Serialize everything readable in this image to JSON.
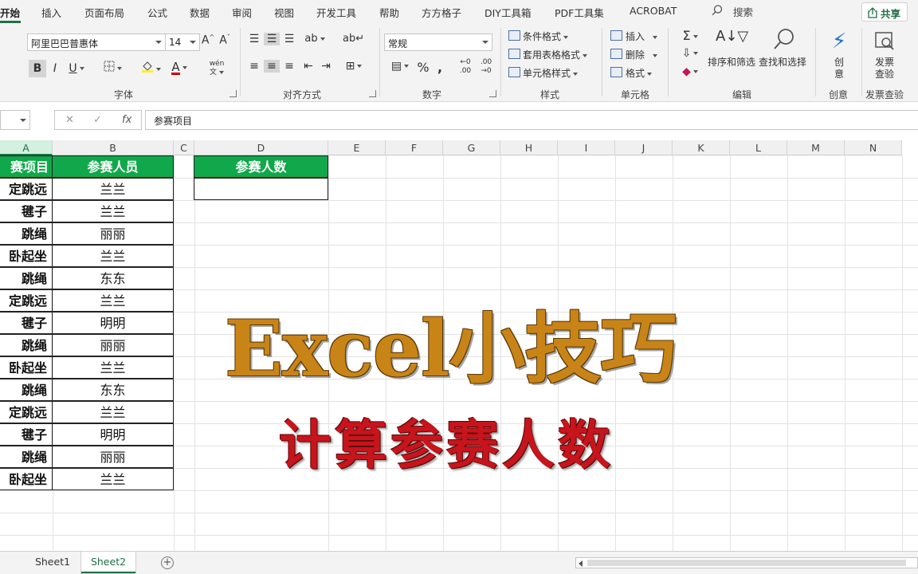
{
  "ribbon_tabs": [
    "开始",
    "插入",
    "页面布局",
    "公式",
    "数据",
    "审阅",
    "视图",
    "开发工具",
    "帮助",
    "方方格子",
    "DIY工具箱",
    "PDF工具集",
    "ACROBAT"
  ],
  "search_label": "搜索",
  "share_label": "共享",
  "font": {
    "name": "阿里巴巴普惠体",
    "size": "14",
    "bold": "B",
    "italic": "I",
    "underline": "U",
    "grow": "A^",
    "shrink": "A˅",
    "phonetic": "wén"
  },
  "number_format": "常规",
  "styles": {
    "conditional": "条件格式",
    "table": "套用表格格式",
    "cell": "单元格样式"
  },
  "cells_group": {
    "insert": "插入",
    "delete": "删除",
    "format": "格式"
  },
  "edit_group": {
    "sort_filter": "排序和筛选",
    "find_select": "查找和选择"
  },
  "creative_label": "创\n意",
  "invoice_label": "发票\n查验",
  "group_labels": {
    "font": "字体",
    "alignment": "对齐方式",
    "number": "数字",
    "styles": "样式",
    "cells": "单元格",
    "editing": "编辑",
    "creative": "创意",
    "invoice": "发票查验"
  },
  "formula_bar": {
    "cancel": "✕",
    "enter": "✓",
    "fx": "fx",
    "value": "参赛项目"
  },
  "columns": [
    "A",
    "B",
    "C",
    "D",
    "E",
    "F",
    "G",
    "H",
    "I",
    "J",
    "K",
    "L",
    "M",
    "N"
  ],
  "table": {
    "headers": [
      "赛项目",
      "参赛人员"
    ],
    "rows": [
      [
        "定跳远",
        "兰兰"
      ],
      [
        "毽子",
        "兰兰"
      ],
      [
        "跳绳",
        "丽丽"
      ],
      [
        "卧起坐",
        "兰兰"
      ],
      [
        "跳绳",
        "东东"
      ],
      [
        "定跳远",
        "兰兰"
      ],
      [
        "毽子",
        "明明"
      ],
      [
        "跳绳",
        "丽丽"
      ],
      [
        "卧起坐",
        "兰兰"
      ],
      [
        "跳绳",
        "东东"
      ],
      [
        "定跳远",
        "兰兰"
      ],
      [
        "毽子",
        "明明"
      ],
      [
        "跳绳",
        "丽丽"
      ],
      [
        "卧起坐",
        "兰兰"
      ]
    ]
  },
  "count_header": "参赛人数",
  "count_value": "",
  "overlay": {
    "title": "Excel小技巧",
    "subtitle": "计算参赛人数"
  },
  "sheets": [
    "Sheet1",
    "Sheet2"
  ],
  "active_sheet": "Sheet2",
  "colors": {
    "accent": "#1e7145",
    "header_green": "#10a84a",
    "title_orange": "#c98418",
    "subtitle_red": "#c8141c"
  }
}
